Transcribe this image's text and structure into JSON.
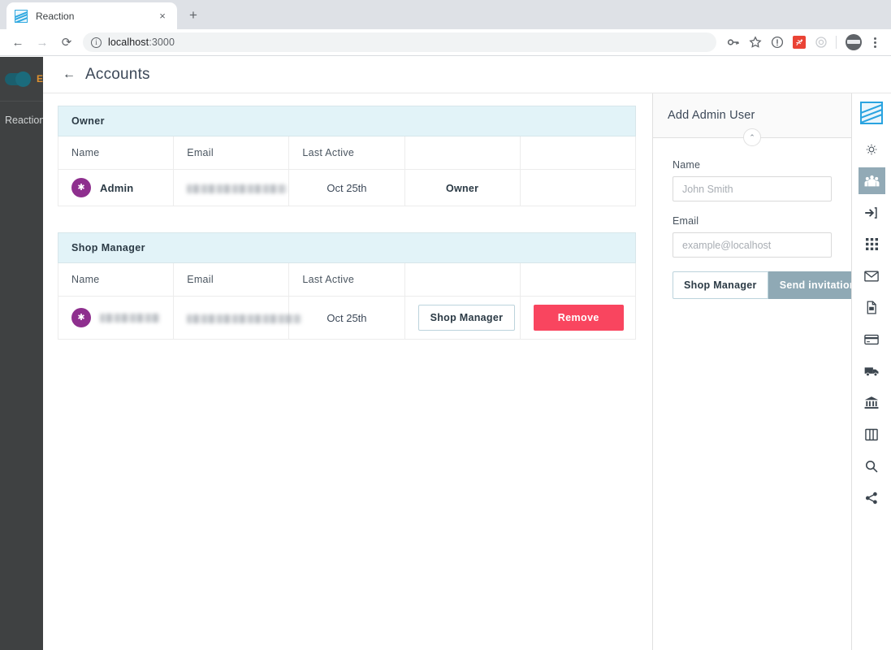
{
  "browser": {
    "tab": {
      "title": "Reaction",
      "favicon": "reaction-logo-icon",
      "close": "×"
    },
    "newtab_label": "+",
    "nav": {
      "back": "←",
      "forward": "→",
      "reload": "⟳"
    },
    "omnibox": {
      "info_glyph": "i",
      "url_host": "localhost",
      "url_port": ":3000"
    },
    "toolbar_icons": [
      {
        "name": "password-key-icon",
        "glyph": "⚷"
      },
      {
        "name": "bookmark-star-icon",
        "glyph": "☆"
      },
      {
        "name": "info-circle-icon",
        "glyph": "!"
      },
      {
        "name": "extension-red-icon",
        "glyph": "▣"
      },
      {
        "name": "extension-circle-icon",
        "glyph": "◎"
      }
    ],
    "profile_label": "profile-avatar",
    "menu_label": "chrome-menu"
  },
  "left_rail": {
    "toggle_state": "on",
    "toggle_label": "E",
    "item_label": "Reaction"
  },
  "header": {
    "back_arrow": "←",
    "title": "Accounts"
  },
  "tables": [
    {
      "section_title": "Owner",
      "columns": [
        "Name",
        "Email",
        "Last Active",
        "",
        ""
      ],
      "rows": [
        {
          "avatar_glyph": "✱",
          "name": "Admin",
          "name_redacted": false,
          "email": "",
          "email_redacted": true,
          "email_blur_width": 123,
          "last_active": "Oct 25th",
          "role": "Owner",
          "role_is_button": false,
          "action": ""
        }
      ]
    },
    {
      "section_title": "Shop Manager",
      "columns": [
        "Name",
        "Email",
        "Last Active",
        "",
        ""
      ],
      "rows": [
        {
          "avatar_glyph": "✱",
          "name": "",
          "name_redacted": true,
          "name_blur_width": 90,
          "email": "",
          "email_redacted": true,
          "email_blur_width": 141,
          "last_active": "Oct 25th",
          "role": "Shop Manager",
          "role_is_button": true,
          "action": "Remove"
        }
      ]
    }
  ],
  "panel": {
    "title": "Add Admin User",
    "collapse_glyph": "⌃",
    "name_label": "Name",
    "name_value": "",
    "name_placeholder": "John Smith",
    "email_label": "Email",
    "email_value": "",
    "email_placeholder": "example@localhost",
    "role_button": "Shop Manager",
    "send_button": "Send invitation"
  },
  "icon_rail": {
    "logo": "reaction-logo-icon",
    "items": [
      {
        "name": "gear-icon",
        "active": false
      },
      {
        "name": "accounts-people-icon",
        "active": true
      },
      {
        "name": "login-enter-icon",
        "active": false
      },
      {
        "name": "grid-apps-icon",
        "active": false
      },
      {
        "name": "mail-envelope-icon",
        "active": false
      },
      {
        "name": "media-file-icon",
        "active": false
      },
      {
        "name": "credit-card-icon",
        "active": false
      },
      {
        "name": "shipping-truck-icon",
        "active": false
      },
      {
        "name": "taxes-bank-icon",
        "active": false
      },
      {
        "name": "layout-columns-icon",
        "active": false
      },
      {
        "name": "search-icon",
        "active": false
      },
      {
        "name": "share-nodes-icon",
        "active": false
      }
    ]
  },
  "colors": {
    "accent_blue": "#29a3e0",
    "section_header_bg": "#e2f3f8",
    "danger": "#f9455f",
    "send_button": "#8fa9b5",
    "avatar_purple": "#8e2f8e",
    "rail_active": "#92aab6",
    "sidebar_dark": "#3f4142",
    "toggle_teal": "#1b6b7c"
  }
}
